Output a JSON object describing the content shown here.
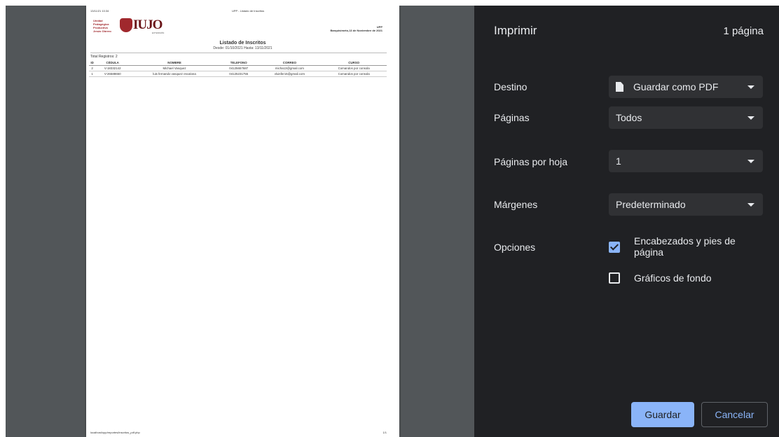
{
  "preview": {
    "header_date": "13/11/21 10:34",
    "header_title": "UPP - Listado de Inscritos",
    "logo_text_lines": [
      "Unidad",
      "Pedagógica",
      "Productiva",
      "Jesús Obrero"
    ],
    "logo_brand": "IUJO",
    "logo_sub": "EXTENSIÓN",
    "org_code": "UPP",
    "location_date": "Barquisimeto,13 de Noviembre de 2021",
    "doc_title": "Listado de Inscritos",
    "doc_range": "Desde: 01/10/2021 Hasta: 13/11/2021",
    "total_label": "Total Registros: 2",
    "table": {
      "headers": [
        "ID",
        "CÉDULA",
        "NOMBRE",
        "TELEFONO",
        "CORREO",
        "CURSO"
      ],
      "rows": [
        [
          "2",
          "V-18332142",
          "Michael Vasquez",
          "04125657687",
          "micha13@gmail.com",
          "Comandos por consola"
        ],
        [
          "1",
          "V-26588650",
          "luis fernando vasquez escalona",
          "04125231755",
          "vluisfer15@gmail.com",
          "Comandos por consola"
        ]
      ]
    },
    "footer_url": "localhost/upp/reportes/inscritos_pdf.php",
    "footer_page": "1/1"
  },
  "panel": {
    "title": "Imprimir",
    "page_count": "1 página",
    "destino": {
      "label": "Destino",
      "value": "Guardar como PDF",
      "icon": "document-icon"
    },
    "paginas": {
      "label": "Páginas",
      "value": "Todos"
    },
    "paginas_hoja": {
      "label": "Páginas por hoja",
      "value": "1"
    },
    "margenes": {
      "label": "Márgenes",
      "value": "Predeterminado"
    },
    "opciones": {
      "label": "Opciones",
      "headers_footers": {
        "label_line1": "Encabezados y pies de",
        "label_line2": "página",
        "checked": true
      },
      "background": {
        "label": "Gráficos de fondo",
        "checked": false
      }
    },
    "save_label": "Guardar",
    "cancel_label": "Cancelar"
  },
  "colors": {
    "panel_bg": "#202124",
    "preview_bg": "#525659",
    "accent": "#8ab4f8",
    "logo_red": "#a0282d"
  }
}
